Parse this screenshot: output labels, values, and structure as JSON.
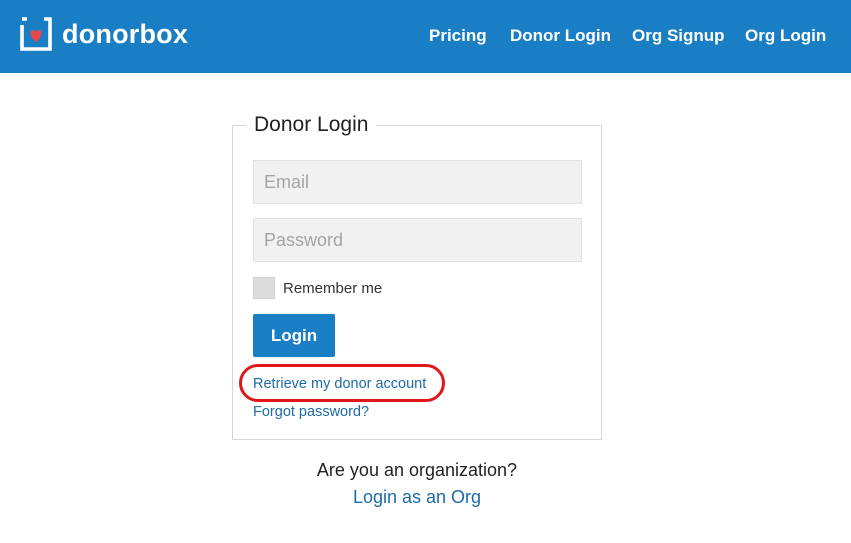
{
  "nav": {
    "brand": "donorbox",
    "links": [
      "Pricing",
      "Donor Login",
      "Org Signup",
      "Org Login"
    ]
  },
  "login": {
    "title": "Donor Login",
    "email_placeholder": "Email",
    "password_placeholder": "Password",
    "remember_label": "Remember me",
    "login_label": "Login",
    "retrieve_link": "Retrieve my donor account",
    "forgot_link": "Forgot password?"
  },
  "org": {
    "question": "Are you an organization?",
    "link": "Login as an Org"
  },
  "colors": {
    "brand_blue": "#1a7ec4",
    "link_blue": "#1d6ba8",
    "highlight_red": "#e1161a",
    "heart_red": "#e8464a"
  },
  "icons": {
    "logo": "heart-in-box-icon"
  }
}
